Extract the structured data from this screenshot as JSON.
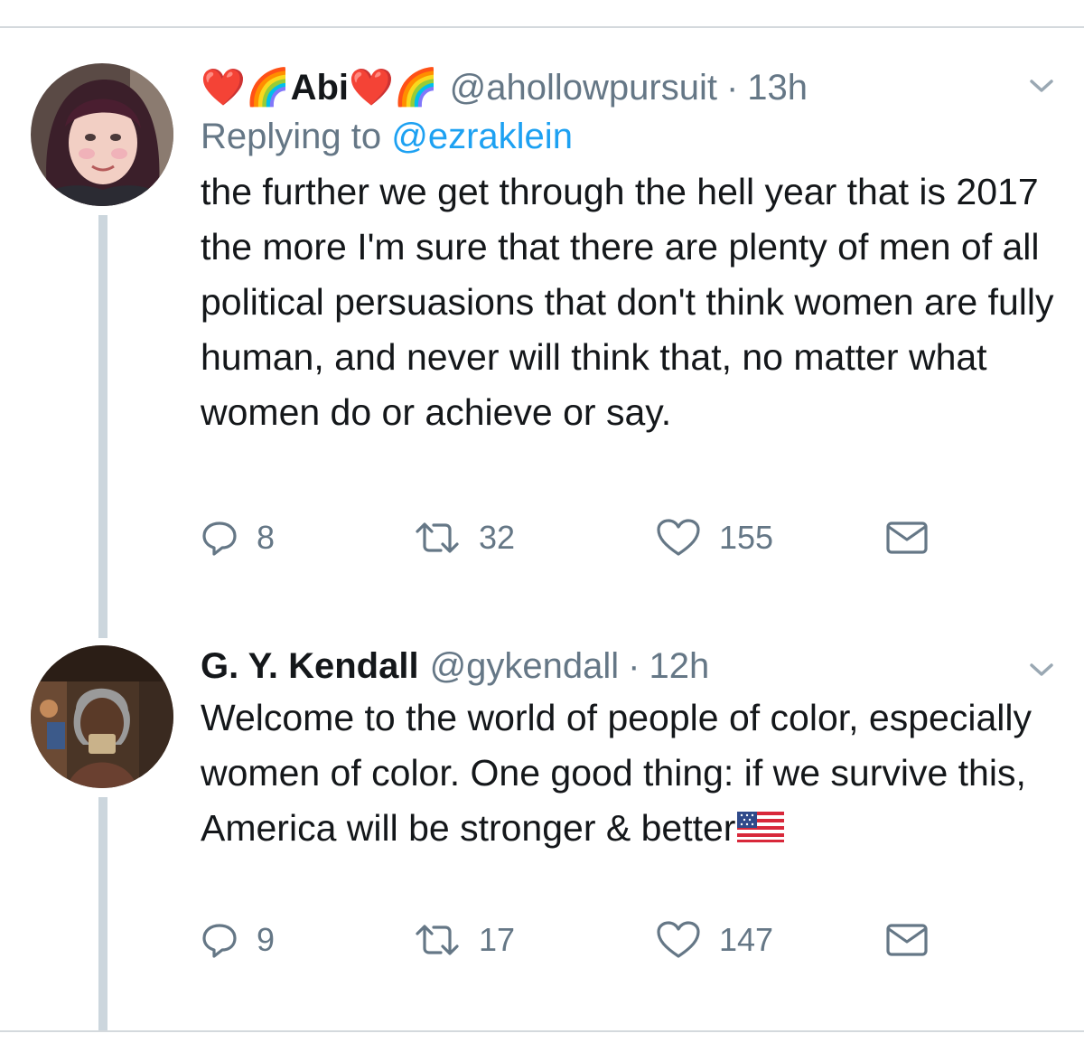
{
  "tweets": [
    {
      "display_name": "❤️🌈Abi❤️🌈",
      "handle": "@ahollowpursuit",
      "separator": "·",
      "time": "13h",
      "replying_prefix": "Replying to",
      "replying_to": "@ezraklein",
      "text": "the further we get through the hell year that is 2017 the more I'm sure that there are plenty of men of all political persuasions that don't think women are fully human, and never will think that, no matter what women do or achieve or say.",
      "replies": "8",
      "retweets": "32",
      "likes": "155"
    },
    {
      "display_name": "G. Y. Kendall",
      "handle": "@gykendall",
      "separator": "·",
      "time": "12h",
      "text": "Welcome to the world of people of color, especially women of color. One good thing: if we survive this, America will be stronger & better",
      "emoji": "us-flag",
      "replies": "9",
      "retweets": "17",
      "likes": "147"
    }
  ],
  "icons": {
    "reply": "reply-icon",
    "retweet": "retweet-icon",
    "like": "heart-icon",
    "dm": "envelope-icon",
    "caret": "chevron-down-icon"
  },
  "colors": {
    "text": "#14171a",
    "secondary": "#657786",
    "link": "#1da1f2",
    "thread_line": "#ccd6dd",
    "divider": "#d4d9dd"
  }
}
